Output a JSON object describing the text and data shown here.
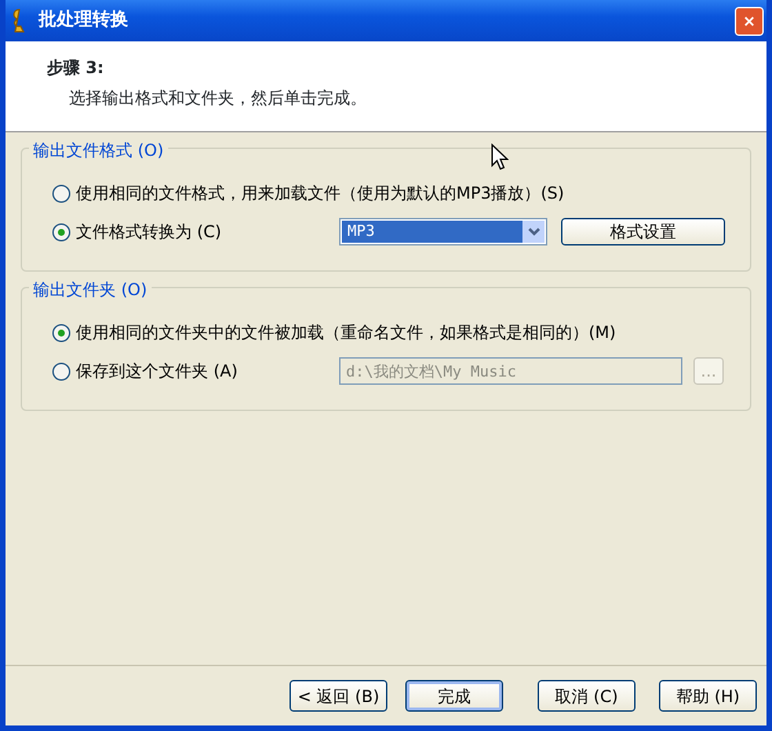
{
  "window": {
    "title": "批处理转换"
  },
  "header": {
    "step": "步骤 3:",
    "instruction": "选择输出格式和文件夹，然后单击完成。"
  },
  "groups": [
    {
      "title": "输出文件格式 (O)",
      "options": [
        {
          "kind": "plain",
          "label": "使用相同的文件格式，用来加载文件（使用为默认的MP3播放）(S)",
          "selected": false
        },
        {
          "kind": "select",
          "label": "文件格式转换为 (C)",
          "selected": true,
          "value": "MP3",
          "button": "格式设置"
        }
      ]
    },
    {
      "title": "输出文件夹 (O)",
      "options": [
        {
          "kind": "plain",
          "label": "使用相同的文件夹中的文件被加载（重命名文件，如果格式是相同的）(M)",
          "selected": true
        },
        {
          "kind": "folder",
          "label": "保存到这个文件夹 (A)",
          "selected": false,
          "value": "d:\\我的文档\\My Music",
          "disabled": true,
          "button": "..."
        }
      ]
    }
  ],
  "buttons": [
    {
      "label": "< 返回 (B)",
      "default": false
    },
    {
      "label": "完成",
      "default": true
    },
    {
      "label": "取消 (C)",
      "default": false
    },
    {
      "label": "帮助 (H)",
      "default": false
    }
  ]
}
